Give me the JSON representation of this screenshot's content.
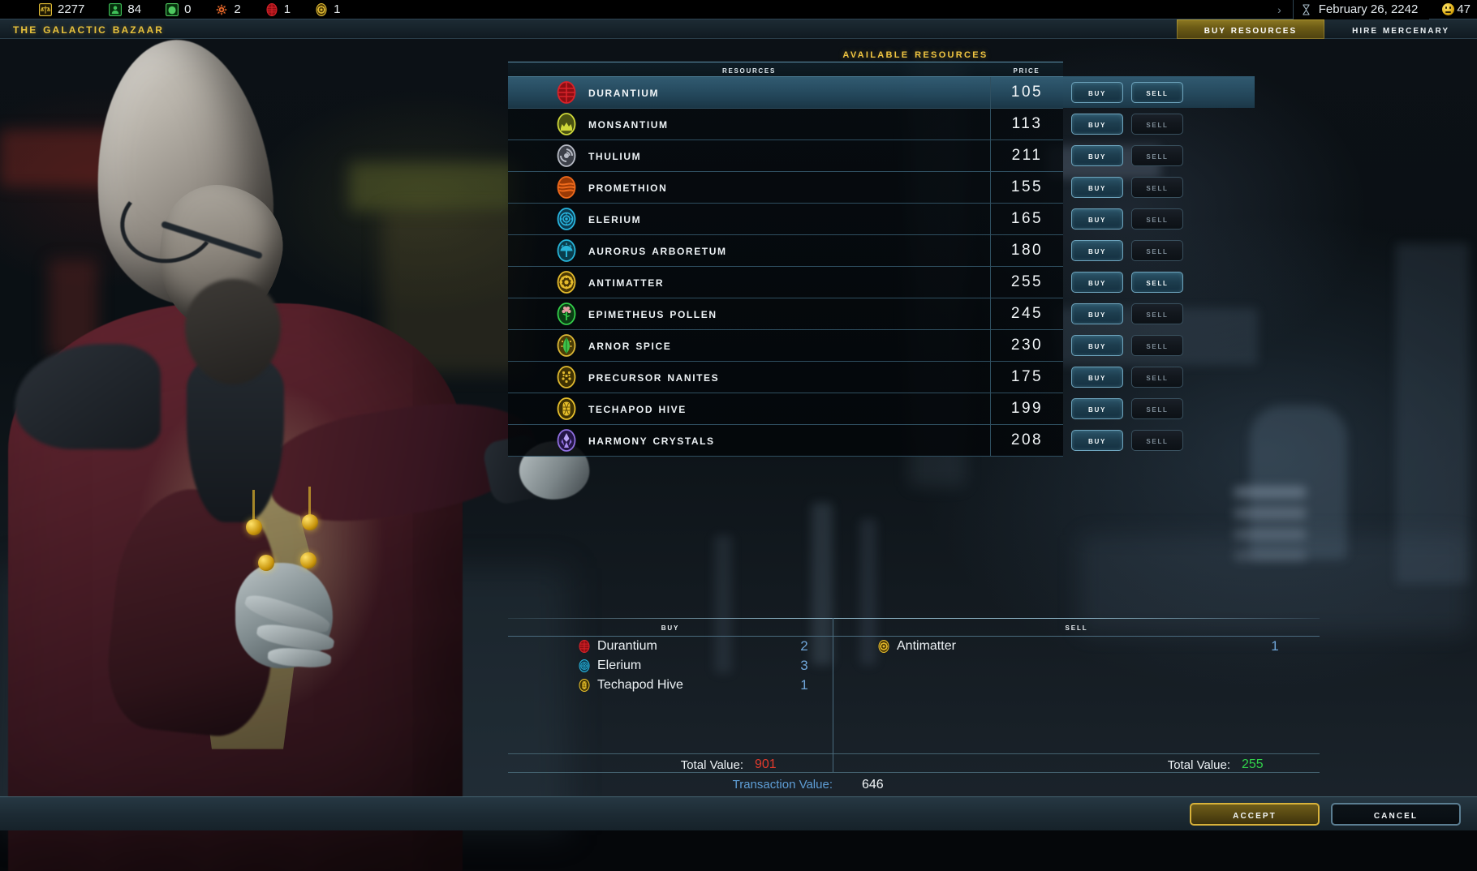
{
  "topbar": {
    "resources": [
      {
        "icon": "credits-icon",
        "label": "Credits",
        "value": "2277",
        "color": "#e0bb35"
      },
      {
        "icon": "population-icon",
        "label": "Population",
        "value": "84",
        "color": "#3fbf58"
      },
      {
        "icon": "food-icon",
        "label": "Food",
        "value": "0",
        "color": "#4ec85f"
      },
      {
        "icon": "research-icon",
        "label": "Research",
        "value": "2",
        "color": "#e8692a"
      },
      {
        "icon": "durantium-icon",
        "label": "Durantium",
        "value": "1",
        "color": "#d8232a"
      },
      {
        "icon": "antimatter-icon",
        "label": "Antimatter",
        "value": "1",
        "color": "#e0bb35"
      }
    ],
    "next_turn_arrow": "›",
    "hourglass_icon": "hourglass-icon",
    "date": "February 26, 2242",
    "approval_icon": "approval-face-icon",
    "approval_value": "47"
  },
  "header": {
    "title": "The Galactic Bazaar",
    "tabs": [
      {
        "label": "Buy Resources",
        "active": true
      },
      {
        "label": "Hire Mercenary",
        "active": false
      }
    ]
  },
  "panel": {
    "available_title": "Available Resources",
    "columns": {
      "resource": "Resources",
      "price": "Price"
    },
    "buy_label": "Buy",
    "sell_label": "Sell",
    "rows": [
      {
        "name": "Durantium",
        "price": "105",
        "icon": "durantium-icon",
        "color": "#d8232a",
        "selected": true,
        "buy_enabled": true,
        "sell_enabled": true
      },
      {
        "name": "Monsantium",
        "price": "113",
        "icon": "monsantium-icon",
        "color": "#cfd83a",
        "selected": false,
        "buy_enabled": true,
        "sell_enabled": false
      },
      {
        "name": "Thulium",
        "price": "211",
        "icon": "thulium-icon",
        "color": "#b8bcc6",
        "selected": false,
        "buy_enabled": true,
        "sell_enabled": false
      },
      {
        "name": "Promethion",
        "price": "155",
        "icon": "promethion-icon",
        "color": "#ef6a1c",
        "selected": false,
        "buy_enabled": true,
        "sell_enabled": false
      },
      {
        "name": "Elerium",
        "price": "165",
        "icon": "elerium-icon",
        "color": "#29b6e0",
        "selected": false,
        "buy_enabled": true,
        "sell_enabled": false
      },
      {
        "name": "Aurorus Arboretum",
        "price": "180",
        "icon": "arboretum-icon",
        "color": "#27b4d8",
        "selected": false,
        "buy_enabled": true,
        "sell_enabled": false
      },
      {
        "name": "Antimatter",
        "price": "255",
        "icon": "antimatter-icon",
        "color": "#e5bb2c",
        "selected": false,
        "buy_enabled": true,
        "sell_enabled": true
      },
      {
        "name": "Epimetheus Pollen",
        "price": "245",
        "icon": "pollen-icon",
        "color": "#34cf4a",
        "selected": false,
        "buy_enabled": true,
        "sell_enabled": false
      },
      {
        "name": "Arnor Spice",
        "price": "230",
        "icon": "spice-icon",
        "color": "#dcb736",
        "selected": false,
        "buy_enabled": true,
        "sell_enabled": false
      },
      {
        "name": "Precursor Nanites",
        "price": "175",
        "icon": "nanites-icon",
        "color": "#e0b92f",
        "selected": false,
        "buy_enabled": true,
        "sell_enabled": false
      },
      {
        "name": "Techapod Hive",
        "price": "199",
        "icon": "techapod-icon",
        "color": "#e8c02c",
        "selected": false,
        "buy_enabled": true,
        "sell_enabled": false
      },
      {
        "name": "Harmony Crystals",
        "price": "208",
        "icon": "harmony-icon",
        "color": "#8f6fe0",
        "selected": false,
        "buy_enabled": true,
        "sell_enabled": false
      }
    ]
  },
  "cart": {
    "buy": {
      "header": "Buy",
      "items": [
        {
          "name": "Durantium",
          "qty": "2",
          "icon": "durantium-icon",
          "color": "#d8232a"
        },
        {
          "name": "Elerium",
          "qty": "3",
          "icon": "elerium-icon",
          "color": "#29b6e0"
        },
        {
          "name": "Techapod Hive",
          "qty": "1",
          "icon": "techapod-icon",
          "color": "#e8c02c"
        }
      ],
      "total_label": "Total Value:",
      "total_value": "901"
    },
    "sell": {
      "header": "Sell",
      "items": [
        {
          "name": "Antimatter",
          "qty": "1",
          "icon": "antimatter-icon",
          "color": "#e5bb2c"
        }
      ],
      "total_label": "Total Value:",
      "total_value": "255"
    },
    "transaction_label": "Transaction Value:",
    "transaction_value": "646"
  },
  "footer": {
    "accept": "Accept",
    "cancel": "Cancel"
  },
  "colors": {
    "accent_gold": "#e8c23c",
    "panel_line": "#2f4f60",
    "negative": "#e03a2c",
    "positive": "#31d14a",
    "qty_blue": "#6fa5d8"
  }
}
